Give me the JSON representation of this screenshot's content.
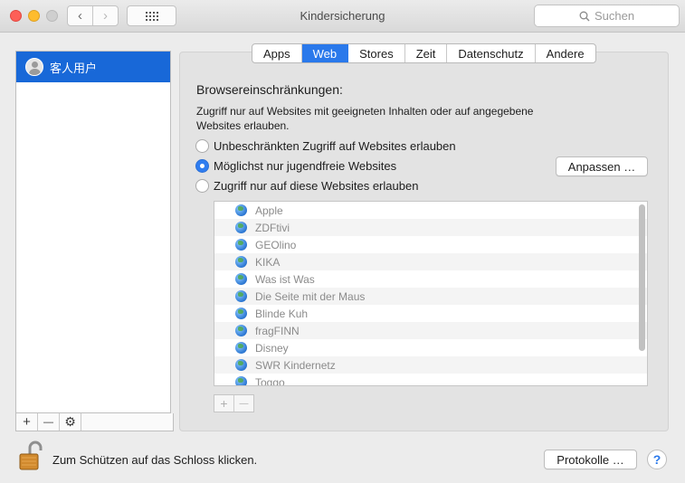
{
  "window": {
    "title": "Kindersicherung"
  },
  "toolbar": {
    "back_glyph": "‹",
    "forward_glyph": "›",
    "search_placeholder": "Suchen"
  },
  "sidebar": {
    "users": [
      {
        "name": "客人用户",
        "selected": true
      }
    ],
    "add_glyph": "+",
    "remove_glyph": "—",
    "gear_glyph": "⚙"
  },
  "tabs": [
    {
      "label": "Apps",
      "active": false
    },
    {
      "label": "Web",
      "active": true
    },
    {
      "label": "Stores",
      "active": false
    },
    {
      "label": "Zeit",
      "active": false
    },
    {
      "label": "Datenschutz",
      "active": false
    },
    {
      "label": "Andere",
      "active": false
    }
  ],
  "web": {
    "heading": "Browsereinschränkungen:",
    "description": "Zugriff nur auf Websites mit geeigneten Inhalten oder auf angegebene Websites erlauben.",
    "options": [
      {
        "label": "Unbeschränkten Zugriff auf Websites erlauben",
        "selected": false
      },
      {
        "label": "Möglichst nur jugendfreie Websites",
        "selected": true
      },
      {
        "label": "Zugriff nur auf diese Websites erlauben",
        "selected": false
      }
    ],
    "customize_button": "Anpassen …",
    "sites": [
      "Apple",
      "ZDFtivi",
      "GEOlino",
      "KIKA",
      "Was ist Was",
      "Die Seite mit der Maus",
      "Blinde Kuh",
      "fragFINN",
      "Disney",
      "SWR Kindernetz",
      "Toggo"
    ],
    "list_add_glyph": "+",
    "list_remove_glyph": "—"
  },
  "footer": {
    "lock_text": "Zum Schützen auf das Schloss klicken.",
    "logs_button": "Protokolle …",
    "help_glyph": "?"
  },
  "colors": {
    "accent": "#2a79eb",
    "selection": "#1868d8"
  }
}
